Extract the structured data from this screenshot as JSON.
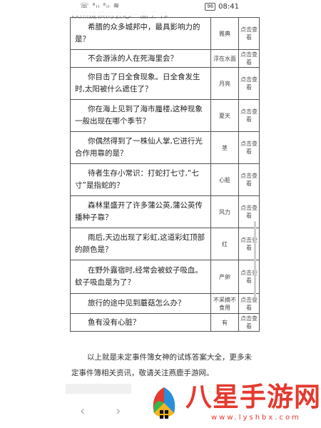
{
  "status_bar": {
    "left_icons": "☏ ᵃᵢₗ ᵃᵢₗ ≋",
    "battery": "96",
    "time": "08:41"
  },
  "cut_off_text": "跃然提供的会心一面工 作 ·",
  "table": {
    "rows": [
      {
        "question": "希腊的众多城邦中，最具影响力的是？",
        "answer": "雅典",
        "action": "点击查看"
      },
      {
        "question": "不会游泳的人在死海里会？",
        "answer": "浮在水面",
        "action": "点击查看"
      },
      {
        "question": "你目击了日全食现象。日全食发生时,太阳被什么遮住了？",
        "answer": "月亮",
        "action": "点击查看"
      },
      {
        "question": "你在海上见到了海市蜃楼,这种现象一般出现在哪个季节？",
        "answer": "夏天",
        "action": "点击查看"
      },
      {
        "question": "你偶然得到了一株仙人掌,它进行光合作用靠的是？",
        "answer": "茎",
        "action": "点击查看"
      },
      {
        "question": "待者生存小常识：打蛇打七寸,“七寸”是指蛇的？",
        "answer": "心脏",
        "action": "点击查看"
      },
      {
        "question": "森林里盛开了许多蒲公英,蒲公英传播种子靠？",
        "answer": "风力",
        "action": "点击查看"
      },
      {
        "question": "雨后,天边出现了彩虹,这道彩虹顶部的颜色是？",
        "answer": "红",
        "action": "点击查看"
      },
      {
        "question": "在野外露宿时,经常会被蚊子吸血。蚊子吸血是为了？",
        "answer": "产卵",
        "action": "点击查看"
      },
      {
        "question": "旅行的途中见到蘑菇怎么办？",
        "answer": "不采摘不食用",
        "action": "点击查看"
      },
      {
        "question": "鱼有没有心脏？",
        "answer": "有",
        "action": "点击查看"
      }
    ]
  },
  "summary": "以上就是未定事件簿女神的试炼答案大全，更多未定事件簿相关资讯，敬请关注燕鹿手游网。",
  "nav": {
    "back": "‹",
    "forward": "›"
  },
  "watermark": {
    "name": "八星手游网",
    "url": "www.lyshbx.com"
  },
  "colors": {
    "text": "#222222",
    "border": "#555555",
    "watermark": "#e43a2f"
  }
}
